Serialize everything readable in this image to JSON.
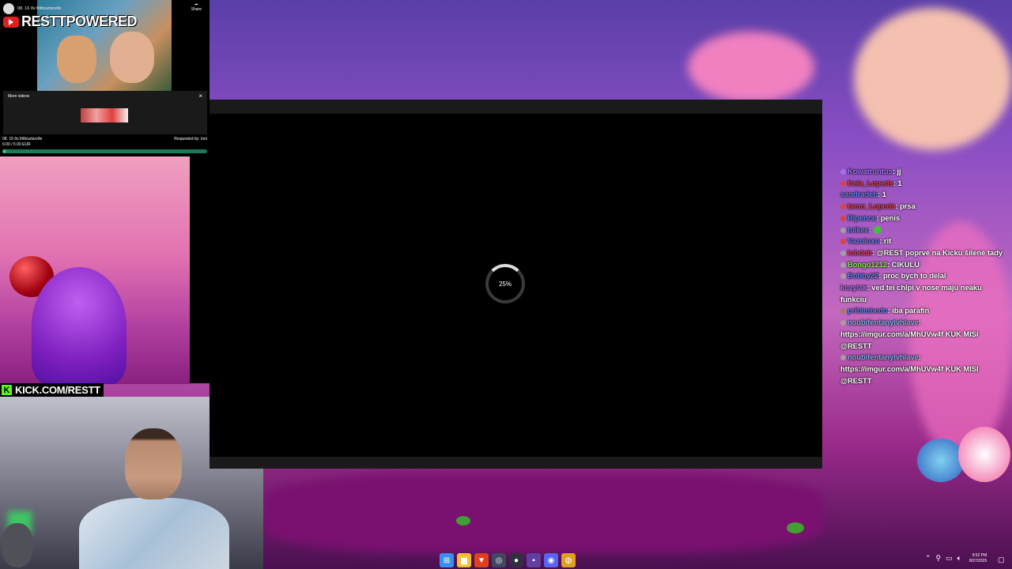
{
  "youtube_widget": {
    "video_title": "08. 16 ős fölfesztarvőe",
    "share_label": "Share",
    "brand": "RESTTPOWERED",
    "more_videos_label": "More videos",
    "close_glyph": "×",
    "now_playing": "08. 16 ős fölfesztarvőe",
    "donation_line": "0.00 / 5.00 EUR",
    "requested_by": "Requested by: Ioni",
    "progress_fraction": 0.02
  },
  "kick": {
    "k_glyph": "K",
    "url": "KICK.COM/RESTT"
  },
  "player": {
    "loading_percent": "25%"
  },
  "chat": {
    "messages": [
      {
        "user": "Kowatruntus",
        "user_color": "#a070f0",
        "badge_color": "#a070f0",
        "text": ": jj"
      },
      {
        "user": "frela_Lopeds",
        "user_color": "#e04040",
        "badge_color": "#e04040",
        "text": ": 1"
      },
      {
        "user": "sandradeb",
        "user_color": "#6080f0",
        "badge_color": "",
        "text": ": 1"
      },
      {
        "user": "tamo_Lopeds",
        "user_color": "#e04040",
        "badge_color": "#e04040",
        "text": ": prsa"
      },
      {
        "user": "Ripence",
        "user_color": "#6080f0",
        "badge_color": "#e04040",
        "text": ": penis"
      },
      {
        "user": "tolkee",
        "user_color": "#6080f0",
        "badge_color": "#a0a0a0",
        "text": ": ",
        "emote": true
      },
      {
        "user": "Vazoloxo",
        "user_color": "#6080f0",
        "badge_color": "#e04040",
        "text": ": rit"
      },
      {
        "user": "lubdob",
        "user_color": "#e04060",
        "badge_color": "#a0a0a0",
        "text": ": @REST poprvé na Kicku šílené tady"
      },
      {
        "user": "Bongo1212",
        "user_color": "#80f040",
        "badge_color": "#a0a0a0",
        "text": ": CIKULU"
      },
      {
        "user": "Bobby22",
        "user_color": "#6080f0",
        "badge_color": "#a0a0a0",
        "text": ": proc bych to delal"
      },
      {
        "user": "kozylak",
        "user_color": "#a070f0",
        "badge_color": "",
        "text": ": ved tei chlpi v nose maju neaku funkciu"
      },
      {
        "user": "pribimbedo",
        "user_color": "#6080f0",
        "badge_color": "#a08060",
        "text": ": iba parafin"
      },
      {
        "user": "noubifentanylvhlave",
        "user_color": "#80b0f0",
        "badge_color": "#a0a0a0",
        "text": ": https://imgur.com/a/MhUVw4f KUK MISI @RESTT"
      },
      {
        "user": "noubifentanylvhlave",
        "user_color": "#80b0f0",
        "badge_color": "#a0a0a0",
        "text": ": https://imgur.com/a/MhUVw4f KUK MISI @RESTT"
      }
    ]
  },
  "taskbar": {
    "apps": [
      {
        "name": "windows-start-icon",
        "color": "#3a90f0",
        "glyph": "⊞"
      },
      {
        "name": "file-explorer-icon",
        "color": "#f0c030",
        "glyph": "▆"
      },
      {
        "name": "brave-browser-icon",
        "color": "#e04020",
        "glyph": "▼"
      },
      {
        "name": "app-icon",
        "color": "#404860",
        "glyph": "◎"
      },
      {
        "name": "obs-icon",
        "color": "#303040",
        "glyph": "●"
      },
      {
        "name": "app-purple-icon",
        "color": "#6040a0",
        "glyph": "▪"
      },
      {
        "name": "discord-icon",
        "color": "#5865f2",
        "glyph": "◉"
      },
      {
        "name": "chrome-icon",
        "color": "#e0a020",
        "glyph": "◍"
      }
    ],
    "time": "9:52 PM",
    "date": "8/27/2025"
  }
}
